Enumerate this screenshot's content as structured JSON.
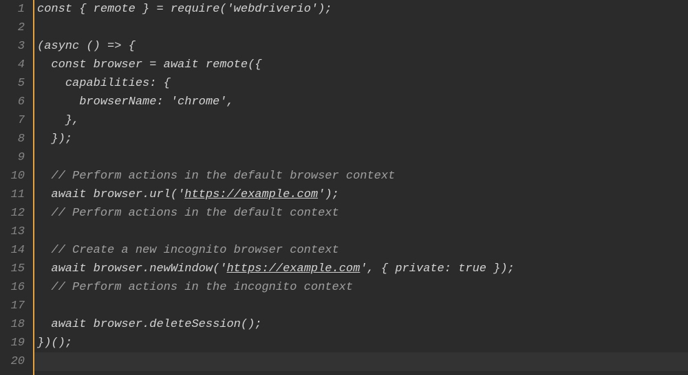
{
  "editor": {
    "lineCount": 20,
    "lines": [
      {
        "num": 1,
        "tokens": [
          {
            "t": "keyword",
            "v": "const"
          },
          {
            "t": "punct",
            "v": " { "
          },
          {
            "t": "ident",
            "v": "remote"
          },
          {
            "t": "punct",
            "v": " } = "
          },
          {
            "t": "func",
            "v": "require"
          },
          {
            "t": "punct",
            "v": "("
          },
          {
            "t": "string",
            "v": "'webdriverio'"
          },
          {
            "t": "punct",
            "v": ");"
          }
        ]
      },
      {
        "num": 2,
        "tokens": []
      },
      {
        "num": 3,
        "tokens": [
          {
            "t": "punct",
            "v": "("
          },
          {
            "t": "keyword",
            "v": "async"
          },
          {
            "t": "punct",
            "v": " () => {"
          }
        ]
      },
      {
        "num": 4,
        "tokens": [
          {
            "t": "punct",
            "v": "  "
          },
          {
            "t": "keyword",
            "v": "const"
          },
          {
            "t": "punct",
            "v": " "
          },
          {
            "t": "ident",
            "v": "browser"
          },
          {
            "t": "punct",
            "v": " = "
          },
          {
            "t": "keyword",
            "v": "await"
          },
          {
            "t": "punct",
            "v": " "
          },
          {
            "t": "func",
            "v": "remote"
          },
          {
            "t": "punct",
            "v": "({"
          }
        ]
      },
      {
        "num": 5,
        "tokens": [
          {
            "t": "punct",
            "v": "    "
          },
          {
            "t": "prop",
            "v": "capabilities"
          },
          {
            "t": "punct",
            "v": ": {"
          }
        ]
      },
      {
        "num": 6,
        "tokens": [
          {
            "t": "punct",
            "v": "      "
          },
          {
            "t": "prop",
            "v": "browserName"
          },
          {
            "t": "punct",
            "v": ": "
          },
          {
            "t": "string",
            "v": "'chrome'"
          },
          {
            "t": "punct",
            "v": ","
          }
        ]
      },
      {
        "num": 7,
        "tokens": [
          {
            "t": "punct",
            "v": "    },"
          }
        ]
      },
      {
        "num": 8,
        "tokens": [
          {
            "t": "punct",
            "v": "  });"
          }
        ]
      },
      {
        "num": 9,
        "tokens": []
      },
      {
        "num": 10,
        "tokens": [
          {
            "t": "punct",
            "v": "  "
          },
          {
            "t": "comment",
            "v": "// Perform actions in the default browser context"
          }
        ]
      },
      {
        "num": 11,
        "tokens": [
          {
            "t": "punct",
            "v": "  "
          },
          {
            "t": "keyword",
            "v": "await"
          },
          {
            "t": "punct",
            "v": " "
          },
          {
            "t": "ident",
            "v": "browser"
          },
          {
            "t": "punct",
            "v": "."
          },
          {
            "t": "func",
            "v": "url"
          },
          {
            "t": "punct",
            "v": "("
          },
          {
            "t": "string",
            "v": "'",
            "u": false
          },
          {
            "t": "string",
            "v": "https://example.com",
            "u": true
          },
          {
            "t": "string",
            "v": "'",
            "u": false
          },
          {
            "t": "punct",
            "v": ");"
          }
        ]
      },
      {
        "num": 12,
        "tokens": [
          {
            "t": "punct",
            "v": "  "
          },
          {
            "t": "comment",
            "v": "// Perform actions in the default context"
          }
        ]
      },
      {
        "num": 13,
        "tokens": []
      },
      {
        "num": 14,
        "tokens": [
          {
            "t": "punct",
            "v": "  "
          },
          {
            "t": "comment",
            "v": "// Create a new incognito browser context"
          }
        ]
      },
      {
        "num": 15,
        "tokens": [
          {
            "t": "punct",
            "v": "  "
          },
          {
            "t": "keyword",
            "v": "await"
          },
          {
            "t": "punct",
            "v": " "
          },
          {
            "t": "ident",
            "v": "browser"
          },
          {
            "t": "punct",
            "v": "."
          },
          {
            "t": "func",
            "v": "newWindow"
          },
          {
            "t": "punct",
            "v": "("
          },
          {
            "t": "string",
            "v": "'",
            "u": false
          },
          {
            "t": "string",
            "v": "https://example.com",
            "u": true
          },
          {
            "t": "string",
            "v": "'",
            "u": false
          },
          {
            "t": "punct",
            "v": ", { "
          },
          {
            "t": "prop",
            "v": "private"
          },
          {
            "t": "punct",
            "v": ": "
          },
          {
            "t": "bool",
            "v": "true"
          },
          {
            "t": "punct",
            "v": " });"
          }
        ]
      },
      {
        "num": 16,
        "tokens": [
          {
            "t": "punct",
            "v": "  "
          },
          {
            "t": "comment",
            "v": "// Perform actions in the incognito context"
          }
        ]
      },
      {
        "num": 17,
        "tokens": []
      },
      {
        "num": 18,
        "tokens": [
          {
            "t": "punct",
            "v": "  "
          },
          {
            "t": "keyword",
            "v": "await"
          },
          {
            "t": "punct",
            "v": " "
          },
          {
            "t": "ident",
            "v": "browser"
          },
          {
            "t": "punct",
            "v": "."
          },
          {
            "t": "func",
            "v": "deleteSession"
          },
          {
            "t": "punct",
            "v": "();"
          }
        ]
      },
      {
        "num": 19,
        "tokens": [
          {
            "t": "punct",
            "v": "})();"
          }
        ]
      },
      {
        "num": 20,
        "tokens": [],
        "highlight": true
      }
    ]
  }
}
